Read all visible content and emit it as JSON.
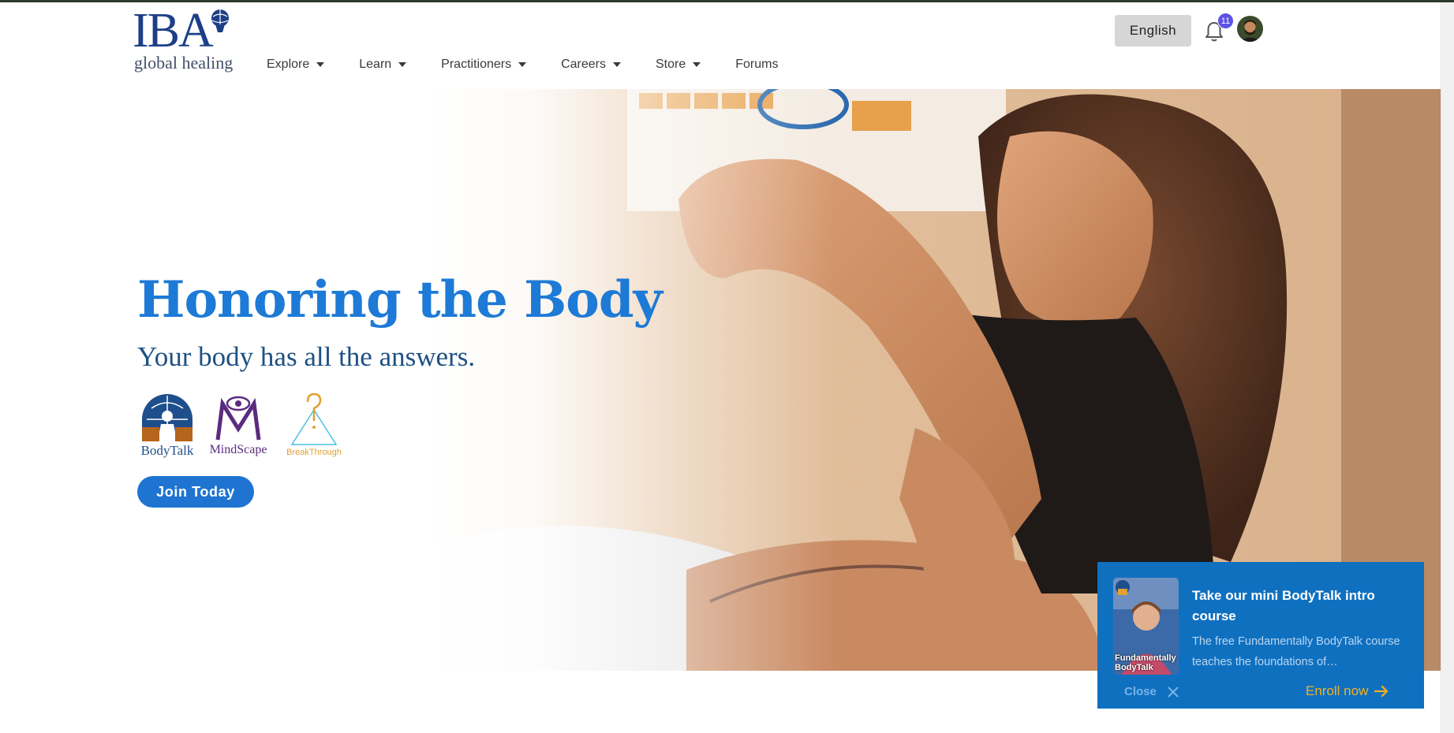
{
  "header": {
    "logo": {
      "mark": "IBA",
      "subtitle": "global healing"
    },
    "nav": [
      {
        "label": "Explore",
        "dropdown": true
      },
      {
        "label": "Learn",
        "dropdown": true
      },
      {
        "label": "Practitioners",
        "dropdown": true
      },
      {
        "label": "Careers",
        "dropdown": true
      },
      {
        "label": "Store",
        "dropdown": true
      },
      {
        "label": "Forums",
        "dropdown": false
      }
    ],
    "language_button": "English",
    "notification_count": "11",
    "icons": {
      "notifications": "bell-icon",
      "profile": "user-avatar"
    }
  },
  "hero": {
    "title": "Honoring the Body",
    "subtitle": "Your body has all the answers.",
    "brands": [
      {
        "label": "BodyTalk",
        "color": "#1e4e8c",
        "accent": "#b5651d"
      },
      {
        "label": "MindScape",
        "color": "#5a2b7f"
      },
      {
        "label": "BreakThrough",
        "color": "#e2a030",
        "accent": "#48c0e0"
      }
    ],
    "cta": "Join Today",
    "colors": {
      "title": "#1d7ad6",
      "subtitle": "#1e5083",
      "cta_bg": "#1e74d0"
    }
  },
  "promo_popup": {
    "thumbnail_caption": "Fundamentally BodyTalk",
    "title": "Take our mini BodyTalk intro course",
    "text": "The free Fundamentally BodyTalk course teaches the foundations of…",
    "close_label": "Close",
    "enroll_label": "Enroll now",
    "colors": {
      "background": "#0f70c0",
      "enroll": "#f5b01e"
    }
  }
}
